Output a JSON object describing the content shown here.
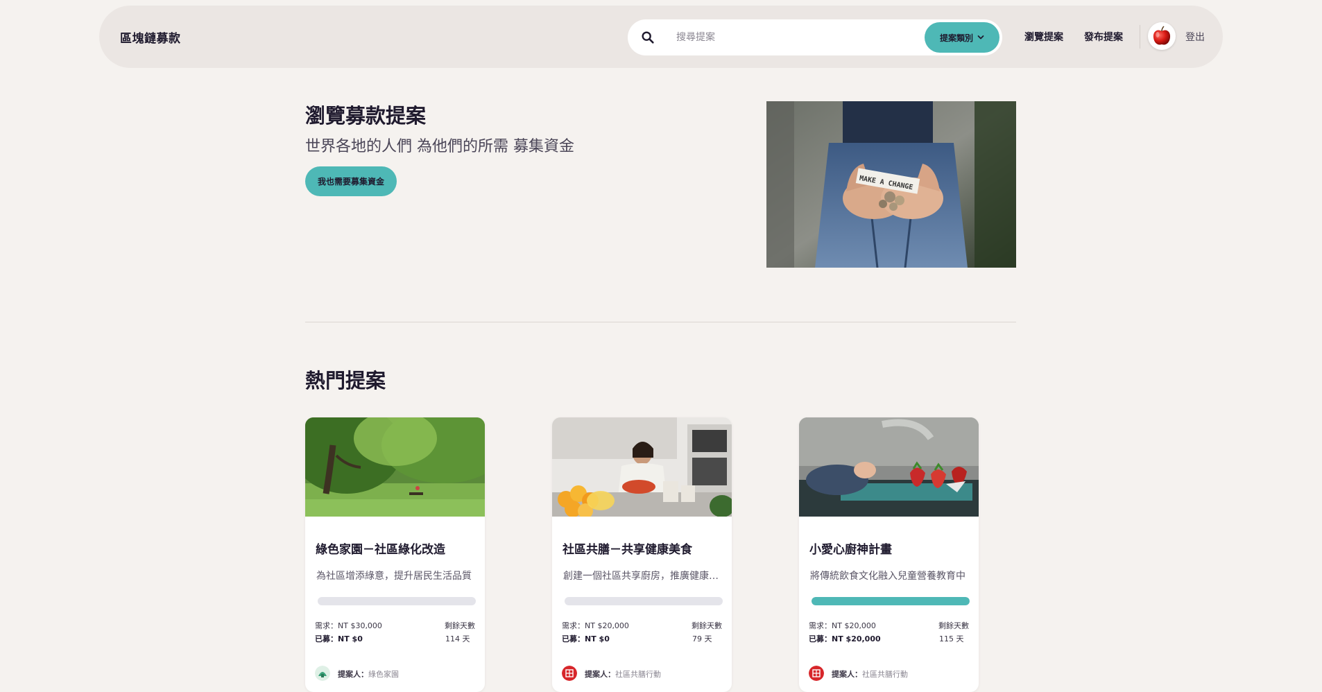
{
  "navbar": {
    "brand": "區塊鏈募款",
    "search_placeholder": "搜尋提案",
    "category_label": "提案類別",
    "browse_label": "瀏覽提案",
    "publish_label": "發布提案",
    "logout_label": "登出"
  },
  "hero": {
    "title": "瀏覽募款提案",
    "subtitle": "世界各地的人們 為他們的所需 募集資金",
    "cta_label": "我也需要募集資金",
    "image_text": "MAKE A CHANGE"
  },
  "section": {
    "title": "熱門提案"
  },
  "cards": [
    {
      "title": "綠色家園－社區綠化改造",
      "desc": "為社區增添綠意，提升居民生活品質",
      "progress": 0,
      "goal_label": "需求：NT $30,000",
      "raised_label": "已募：NT $0",
      "days_label": "剩餘天數",
      "days_value": "114 天",
      "proposer_prefix": "提案人：",
      "proposer_name": "綠色家園"
    },
    {
      "title": "社區共膳－共享健康美食",
      "desc": "創建一個社區共享廚房，推廣健康飲食",
      "progress": 0,
      "goal_label": "需求：NT $20,000",
      "raised_label": "已募：NT $0",
      "days_label": "剩餘天數",
      "days_value": "79 天",
      "proposer_prefix": "提案人：",
      "proposer_name": "社區共膳行動"
    },
    {
      "title": "小愛心廚神計畫",
      "desc": "將傳統飲食文化融入兒童營養教育中",
      "progress": 1,
      "goal_label": "需求：NT $20,000",
      "raised_label": "已募：NT $20,000",
      "days_label": "剩餘天數",
      "days_value": "115 天",
      "proposer_prefix": "提案人：",
      "proposer_name": "社區共膳行動"
    }
  ],
  "colors": {
    "accent": "#4eb8b6",
    "background": "#f5f2ef",
    "navbar": "#ebe6e3",
    "text": "#1f1a2e"
  },
  "icons": [
    "search-icon",
    "chevron-down-icon",
    "apple-avatar-icon"
  ]
}
